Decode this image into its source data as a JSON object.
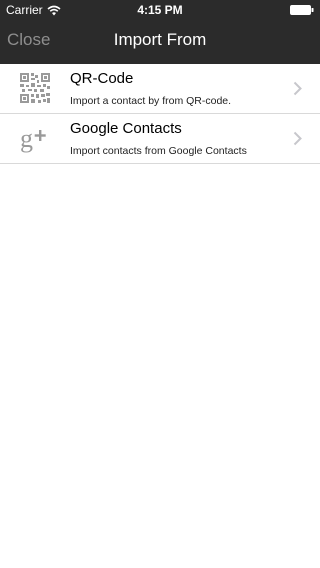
{
  "status_bar": {
    "carrier": "Carrier",
    "time": "4:15 PM"
  },
  "nav": {
    "close_label": "Close",
    "title": "Import From"
  },
  "rows": [
    {
      "icon": "qr-code-icon",
      "title": "QR-Code",
      "subtitle": "Import a contact by from QR-code."
    },
    {
      "icon": "google-plus-icon",
      "title": "Google Contacts",
      "subtitle": "Import contacts from Google Contacts"
    }
  ],
  "colors": {
    "header_background": "#2b2b2b",
    "close_text": "#8e8e8e",
    "separator": "#d9d9d9",
    "icon_gray": "#9a9a9a"
  }
}
